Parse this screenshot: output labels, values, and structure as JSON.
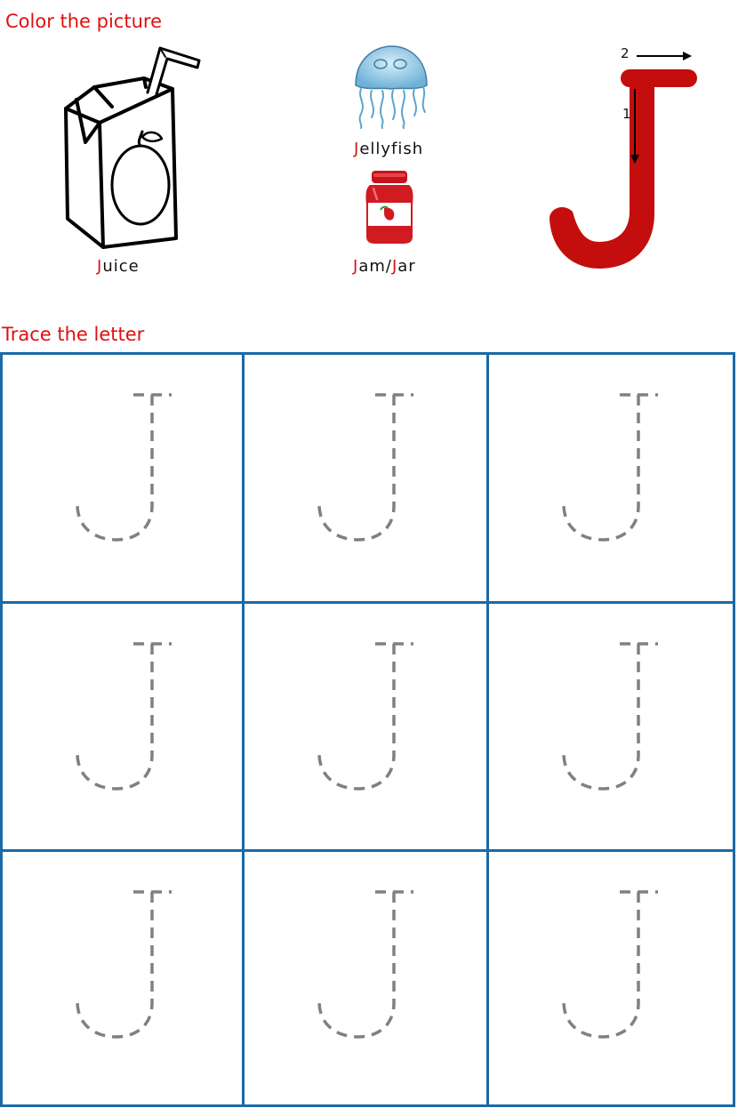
{
  "headings": {
    "color": "Color the picture",
    "trace": "Trace the letter"
  },
  "pictures": [
    {
      "cap": "J",
      "rest": "uice"
    },
    {
      "cap": "J",
      "rest": "ellyfish"
    },
    {
      "cap": "J",
      "rest": "am/",
      "cap2": "J",
      "rest2": "ar"
    }
  ],
  "stroke_guide": {
    "stroke1": "1",
    "stroke2": "2"
  },
  "colors": {
    "heading": "#e01010",
    "letter": "#c40d0d",
    "grid": "#1a6aa8",
    "trace": "#808080"
  },
  "trace_grid": {
    "rows": 3,
    "cols": 3
  }
}
